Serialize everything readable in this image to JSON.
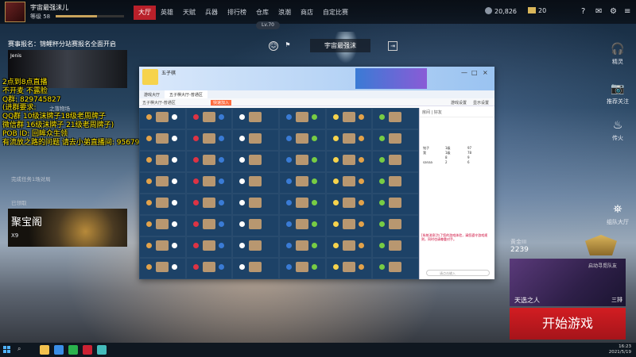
{
  "player": {
    "name": "宇宙最强沫儿",
    "level_label": "等级 58",
    "xp_fraction": 0.6
  },
  "nav": [
    {
      "label": "大厅",
      "active": true
    },
    {
      "label": "英雄",
      "active": false
    },
    {
      "label": "天赋",
      "active": false
    },
    {
      "label": "兵器",
      "active": false
    },
    {
      "label": "排行榜",
      "active": false
    },
    {
      "label": "仓库",
      "active": false
    },
    {
      "label": "浪潮",
      "active": false
    },
    {
      "label": "商店",
      "active": false
    },
    {
      "label": "自定比赛",
      "active": false
    }
  ],
  "currency": {
    "coins": "20,826",
    "gold": "20"
  },
  "lv_pill": "Lv.70",
  "guild": {
    "name": "宇宙最强沫"
  },
  "event": {
    "title": "赛事报名：锦鲤杯分站赛报名全面开启",
    "logo": "Jenis"
  },
  "overlay_text": "2点到8点直播\n不开麦 不露脸\nQ群: 829745827\n(进群要求:\nQQ群 10级沫牌子18级老周牌子\n微信群 16级沫牌子 21级老周牌子)\nPOB ID: 回眸众生领\n有流放之路的问题 请去小弟直播间: 9567921",
  "left_misc": [
    {
      "text": "之落物场"
    },
    {
      "text": "完成任务1场对局"
    },
    {
      "text": "已领取"
    }
  ],
  "treasure": {
    "title": "聚宝阁",
    "count": "X9"
  },
  "right_sidebar": [
    {
      "label": "精灵",
      "icon": "headset-icon"
    },
    {
      "label": "推荐关注",
      "icon": "camera-icon"
    },
    {
      "label": "传火",
      "icon": "flame-icon"
    },
    {
      "label": "组队大厅",
      "icon": "team-lantern-icon"
    }
  ],
  "rank": {
    "label": "黄金III",
    "score": "2239",
    "hint": "启动寻觅队友"
  },
  "hero": {
    "name": "天选之人",
    "mode": "三排"
  },
  "start_button": "开始游戏",
  "chat_window": {
    "title": "五子棋",
    "tabs": [
      "游戏大厅",
      "五子棋大厅-普通区"
    ],
    "toolbar": [
      "五子棋大厅-普通区",
      "快速加入",
      "游戏设置",
      "显示设置"
    ],
    "sidebar_title": "房间 | 好友",
    "players": [
      {
        "name": "铭子",
        "a": "1级",
        "b": "97"
      },
      {
        "name": "我",
        "a": "1级",
        "b": "78"
      },
      {
        "name": "",
        "a": "8",
        "b": "9"
      },
      {
        "name": "sanaa",
        "a": "2",
        "b": "6"
      },
      {
        "name": "",
        "a": "",
        "b": ""
      },
      {
        "name": "",
        "a": "",
        "b": ""
      }
    ],
    "message": "[系统消息]为了您的游戏体验，请您遵守游戏规则，同时也请尊重对手。",
    "input_placeholder": "请点击输入"
  },
  "taskbar": {
    "search": "⌕",
    "time": "16:23",
    "date": "2021/5/19"
  },
  "colors": {
    "accent_red": "#b9202a",
    "start_red": "#d21d22",
    "overlay_yellow": "#ffe600",
    "chat_bg": "#1d4267"
  }
}
